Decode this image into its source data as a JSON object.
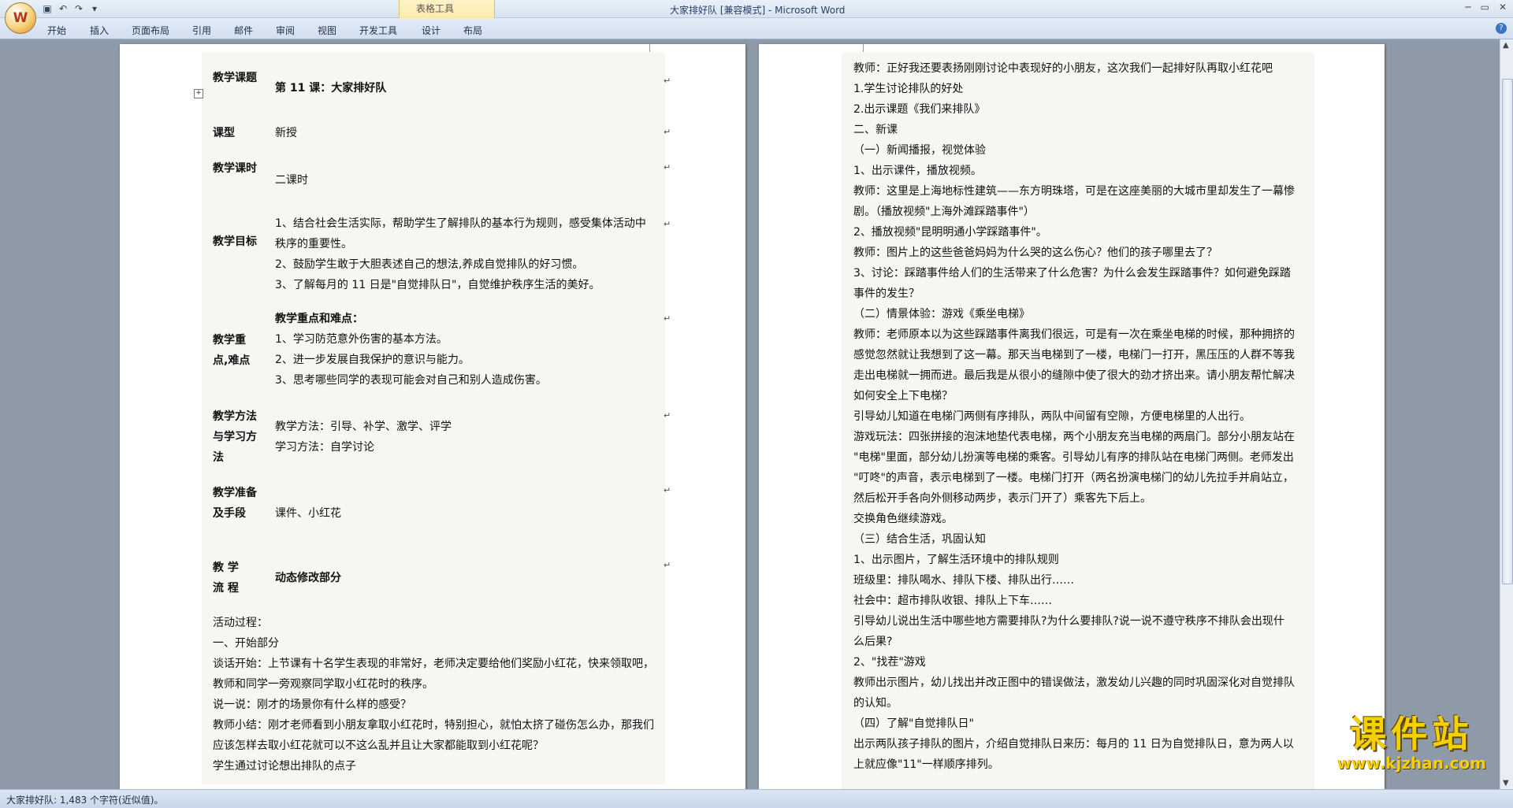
{
  "window": {
    "title": "大家排好队 [兼容模式] - Microsoft Word",
    "context_tab_label": "表格工具",
    "office_button_icon": "office-logo-icon",
    "quick_access": [
      "save-icon",
      "undo-icon",
      "redo-icon",
      "customize-icon"
    ]
  },
  "ribbon": {
    "tabs": [
      "开始",
      "插入",
      "页面布局",
      "引用",
      "邮件",
      "审阅",
      "视图",
      "开发工具",
      "设计",
      "布局"
    ]
  },
  "left_page": {
    "table_rows": [
      {
        "label": "教学课题",
        "content": [
          "第 11 课：大家排好队"
        ]
      },
      {
        "label": "课型",
        "content": [
          "新授"
        ]
      },
      {
        "label": "教学课时",
        "content": [
          "二课时"
        ]
      },
      {
        "label": "教学目标",
        "content": [
          "1、结合社会生活实际，帮助学生了解排队的基本行为规则，感受集体活动中",
          "秩序的重要性。",
          "2、鼓励学生敢于大胆表述自己的想法,养成自觉排队的好习惯。",
          "3、了解每月的 11 日是\"自觉排队日\"，自觉维护秩序生活的美好。"
        ]
      },
      {
        "label": "教学重点,难点",
        "content": [
          "教学重点和难点：",
          "1、学习防范意外伤害的基本方法。",
          "2、进一步发展自我保护的意识与能力。",
          "3、思考哪些同学的表现可能会对自己和别人造成伤害。"
        ]
      },
      {
        "label": "教学方法与学习方法",
        "content": [
          "教学方法：引导、补学、激学、评学",
          "学习方法：自学讨论"
        ]
      },
      {
        "label": "教学准备及手段",
        "content": [
          "课件、小红花"
        ]
      },
      {
        "label": "教 学 流 程",
        "content": [
          "动态修改部分"
        ]
      }
    ],
    "body": [
      "活动过程：",
      "一、开始部分",
      "谈话开始：上节课有十名学生表现的非常好，老师决定要给他们奖励小红花，快来领取吧，",
      "教师和同学一旁观察同学取小红花时的秩序。",
      "说一说：刚才的场景你有什么样的感受？",
      "教师小结：刚才老师看到小朋友拿取小红花时，特别担心，就怕太挤了碰伤怎么办，那我们",
      "应该怎样去取小红花就可以不这么乱并且让大家都能取到小红花呢？",
      "学生通过讨论想出排队的点子"
    ]
  },
  "right_page": {
    "body": [
      "教师：正好我还要表扬刚刚讨论中表现好的小朋友，这次我们一起排好队再取小红花吧",
      "1.学生讨论排队的好处",
      "2.出示课题《我们来排队》",
      "二、新课",
      "（一）新闻播报，视觉体验",
      "1、出示课件，播放视频。",
      "教师：这里是上海地标性建筑——东方明珠塔，可是在这座美丽的大城市里却发生了一幕惨",
      "剧。（播放视频\"上海外滩踩踏事件\"）",
      "2、播放视频\"昆明明通小学踩踏事件\"。",
      "教师：图片上的这些爸爸妈妈为什么哭的这么伤心？他们的孩子哪里去了？",
      "3、讨论：踩踏事件给人们的生活带来了什么危害？为什么会发生踩踏事件？如何避免踩踏",
      "事件的发生？",
      "（二）情景体验：游戏《乘坐电梯》",
      "教师：老师原本以为这些踩踏事件离我们很远，可是有一次在乘坐电梯的时候，那种拥挤的",
      "感觉忽然就让我想到了这一幕。那天当电梯到了一楼，电梯门一打开，黑压压的人群不等我",
      "走出电梯就一拥而进。最后我是从很小的缝隙中使了很大的劲才挤出来。请小朋友帮忙解决",
      "如何安全上下电梯？",
      "引导幼儿知道在电梯门两侧有序排队，两队中间留有空隙，方便电梯里的人出行。",
      "游戏玩法：四张拼接的泡沫地垫代表电梯，两个小朋友充当电梯的两扇门。部分小朋友站在",
      "\"电梯\"里面，部分幼儿扮演等电梯的乘客。引导幼儿有序的排队站在电梯门两侧。老师发出",
      "\"叮咚\"的声音，表示电梯到了一楼。电梯门打开（两名扮演电梯门的幼儿先拉手并肩站立，",
      "然后松开手各向外侧移动两步，表示门开了）乘客先下后上。",
      "交换角色继续游戏。",
      "（三）结合生活，巩固认知",
      "1、出示图片，了解生活环境中的排队规则",
      "班级里：排队喝水、排队下楼、排队出行……",
      "社会中：超市排队收银、排队上下车……",
      "引导幼儿说出生活中哪些地方需要排队?为什么要排队?说一说不遵守秩序不排队会出现什",
      "么后果?",
      "2、\"找茬\"游戏",
      "教师出示图片，幼儿找出并改正图中的错误做法，激发幼儿兴趣的同时巩固深化对自觉排队",
      "的认知。",
      "（四）了解\"自觉排队日\"",
      "出示两队孩子排队的图片，介绍自觉排队日来历：每月的 11 日为自觉排队日，意为两人以",
      "上就应像\"11\"一样顺序排列。"
    ]
  },
  "status_bar": {
    "text": "大家排好队: 1,483 个字符(近似值)。"
  },
  "watermark": {
    "main": "课件站",
    "url": "www.kjzhan.com"
  },
  "colors": {
    "accent": "#f5d000",
    "ribbon": "#d2dfef",
    "workspace": "#8f9aa8"
  }
}
